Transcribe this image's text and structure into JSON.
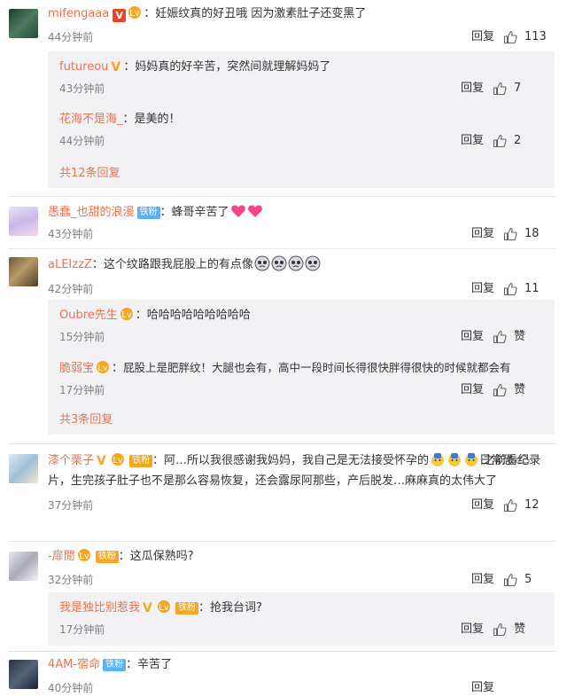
{
  "comments": [
    {
      "user": "mifengaaa",
      "text": "妊娠纹真的好丑哦 因为激素肚子还变黑了",
      "time": "44分钟前",
      "likes": "113",
      "replies": [
        {
          "user": "futureou",
          "text": "妈妈真的好辛苦，突然间就理解妈妈了",
          "time": "43分钟前",
          "likes": "7"
        },
        {
          "user": "花海不是海_",
          "text": "是美的！",
          "time": "44分钟前",
          "likes": "2"
        }
      ],
      "more": "共12条回复"
    },
    {
      "user": "愚蠢_也甜的浪漫",
      "fan_badge": "铁粉",
      "text": "蜂哥辛苦了",
      "time": "43分钟前",
      "likes": "18"
    },
    {
      "user": "aLEIzzZ",
      "text": "这个纹路跟我屁股上的有点像",
      "time": "42分钟前",
      "likes": "11",
      "replies": [
        {
          "user": "Oubre先生",
          "text": "哈哈哈哈哈哈哈哈哈",
          "time": "15分钟前",
          "likes": "赞"
        },
        {
          "user": "脆弱宝",
          "text": "屁股上是肥胖纹！大腿也会有，高中一段时间长得很快胖得很快的时候就都会有",
          "time": "17分钟前",
          "likes": "赞"
        }
      ],
      "more": "共3条回复"
    },
    {
      "user": "漆个栗子",
      "fan_badge": "铁粉",
      "text_line1": "阿…所以我很感谢我妈妈，我自己是无法接受怀孕的",
      "text_line1_tail": "日常恐",
      "text_rest": "之前看纪录片，生完孩子肚子也不是那么容易恢复，还会露尿阿那些，产后脱发…麻麻真的太伟大了",
      "time": "37分钟前",
      "likes": "12"
    },
    {
      "user": "-扉閒",
      "fan_badge": "铁粉",
      "text": "这瓜保熟吗?",
      "time": "32分钟前",
      "likes": "5",
      "replies": [
        {
          "user": "我是独比别惹我",
          "fan_badge": "铁粉",
          "text": "抢我台词?",
          "time": "17分钟前",
          "likes": "赞"
        }
      ]
    },
    {
      "user": "4AM-宿命",
      "fan_badge": "铁粉",
      "text": "辛苦了",
      "time": "40分钟前"
    }
  ],
  "labels": {
    "reply": "回复",
    "colon": "："
  },
  "colors": {
    "username": "#eb7350",
    "subbox_bg": "#f2f2f5",
    "verified_red": "#e9452b",
    "verified_yellow": "#f6a623",
    "fan_blue": "#5ab0ff"
  },
  "icons": {
    "like": "thumbs-up-icon"
  }
}
